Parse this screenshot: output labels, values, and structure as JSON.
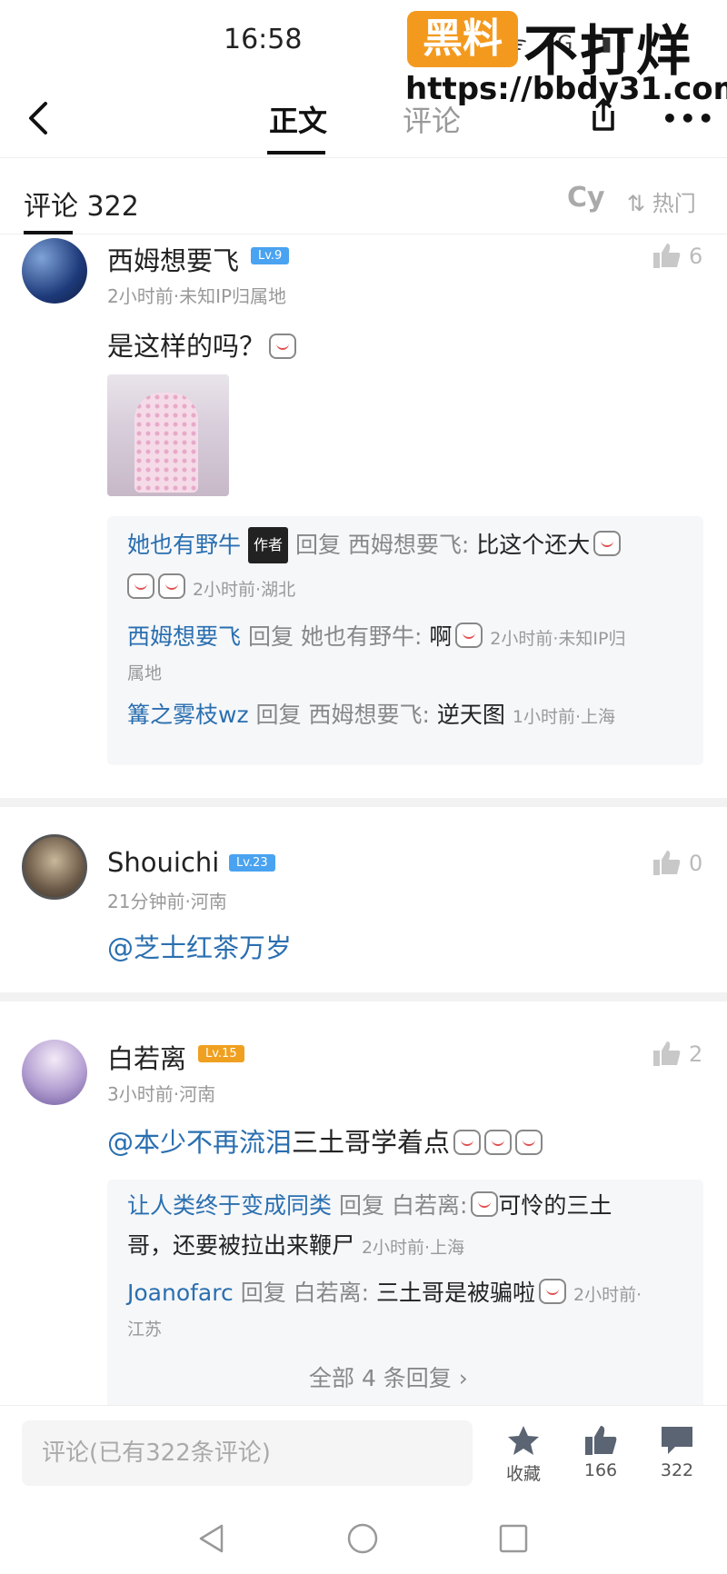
{
  "status_bar": {
    "time": "16:58",
    "icons_text": "ᯤ 4G ▮▮▮",
    "watermark_badge": "黑料",
    "watermark_text": "不打烊",
    "watermark_url": "https://bbdy31.com"
  },
  "nav": {
    "tab_article": "正文",
    "tab_comments": "评论",
    "more_label": "•••"
  },
  "comments_header": {
    "title": "评论  322",
    "cy_label": "Cy",
    "sort_label": "热门"
  },
  "comments": [
    {
      "user": "西姆想要飞",
      "level": "Lv.9",
      "meta": "2小时前·未知IP归属地",
      "likes": "6",
      "text": "是这样的吗？",
      "replies": [
        {
          "user": "她也有野牛",
          "tag": "作者",
          "reply_word": "回复",
          "to": "西姆想要飞:",
          "text": "比这个还大",
          "time": "2小时前·湖北"
        },
        {
          "user": "西姆想要飞",
          "reply_word": "回复",
          "to": "她也有野牛:",
          "text": "啊",
          "time_1": "2小时前·未知IP归",
          "time_2": "属地"
        },
        {
          "user": "篝之雾枝wz",
          "reply_word": "回复",
          "to": "西姆想要飞:",
          "text": "逆天图",
          "time": "1小时前·上海"
        }
      ]
    },
    {
      "user": "Shouichi",
      "level": "Lv.23",
      "meta": "21分钟前·河南",
      "likes": "0",
      "text": "@芝士红茶万岁"
    },
    {
      "user": "白若离",
      "level": "Lv.15",
      "meta": "3小时前·河南",
      "likes": "2",
      "text_mention": "@本少不再流泪",
      "text_rest": "三土哥学着点",
      "replies": [
        {
          "user": "让人类终于变成同类",
          "reply_word": "回复",
          "to": "白若离:",
          "text_1": "可怜的三土",
          "text_2": "哥，还要被拉出来鞭尸",
          "time": "2小时前·上海"
        },
        {
          "user": "Joanofarc",
          "reply_word": "回复",
          "to": "白若离:",
          "text": "三土哥是被骗啦",
          "time_1": "2小时前·",
          "time_2": "江苏"
        }
      ],
      "more_replies": "全部 4 条回复 ›"
    }
  ],
  "bottom_bar": {
    "input_placeholder": "评论(已有322条评论)",
    "favorite_label": "收藏",
    "like_count": "166",
    "comment_count": "322"
  },
  "colors": {
    "accent_blue": "#2a6fb0",
    "level_blue": "#4aa3f0",
    "level_orange": "#f0a020",
    "watermark_orange": "#f39a1e"
  }
}
